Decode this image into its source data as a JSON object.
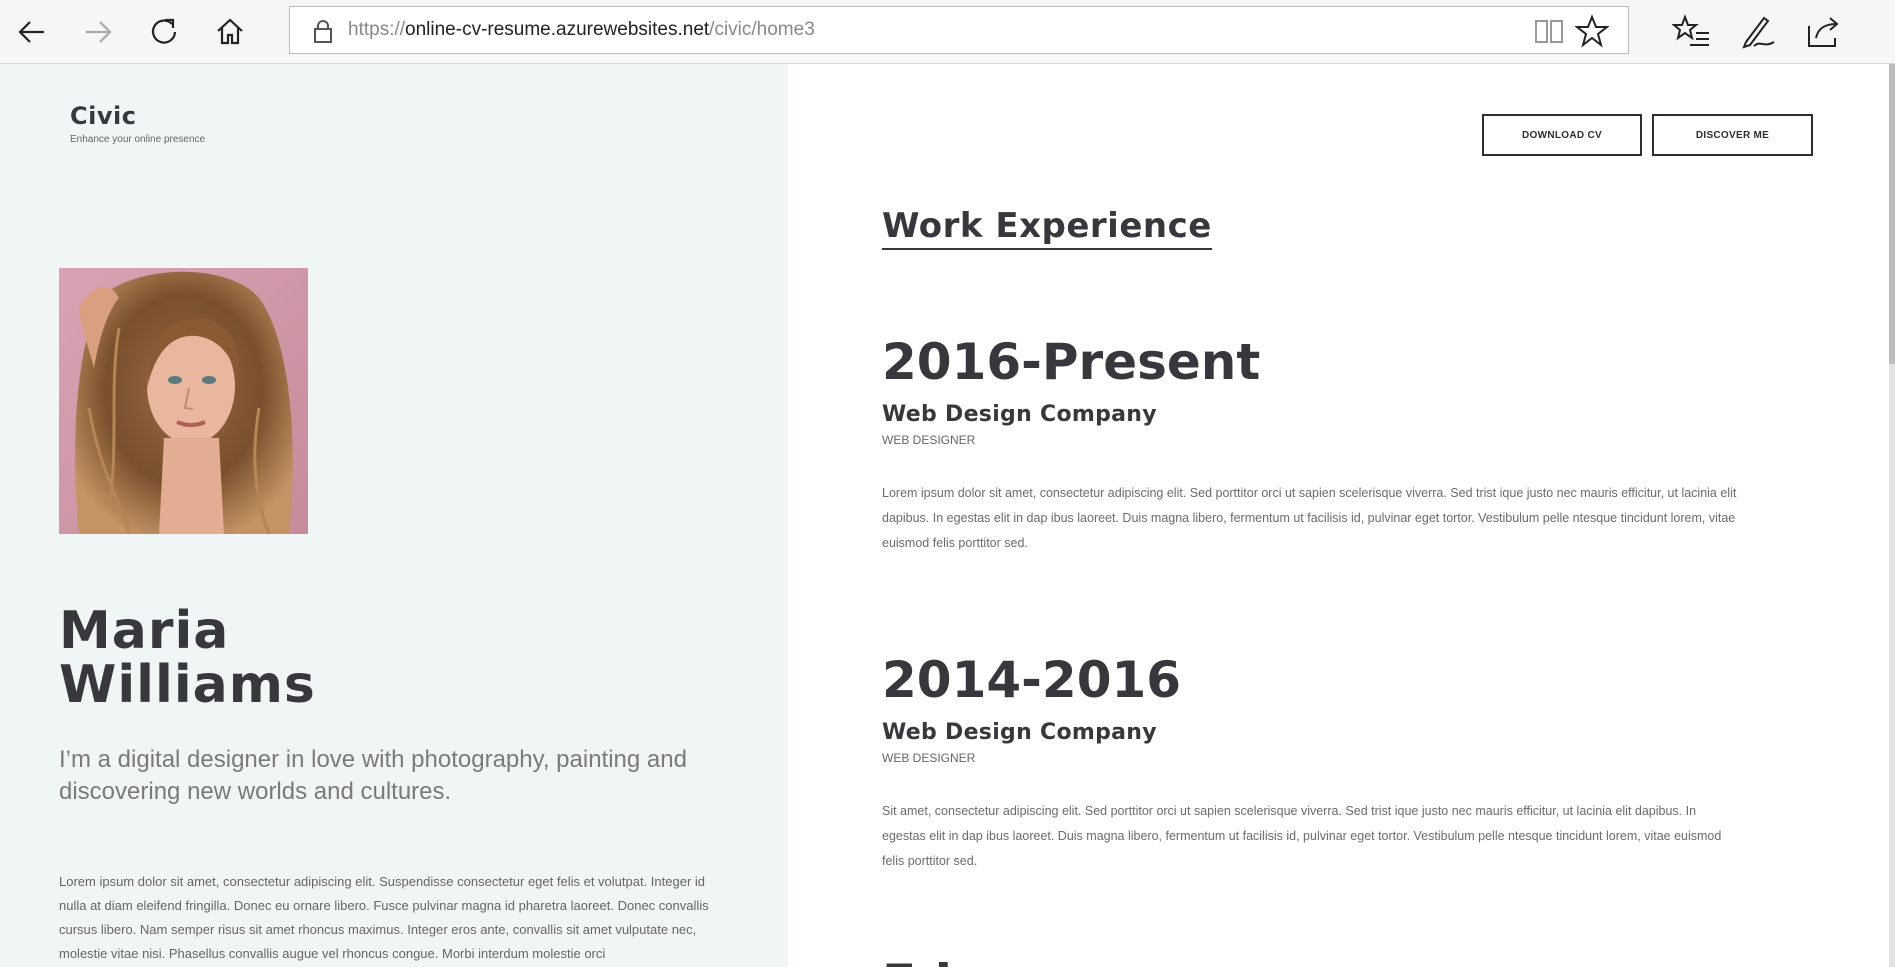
{
  "browser": {
    "url_scheme": "https://",
    "url_host": "online-cv-resume.azurewebsites.net",
    "url_path": "/civic/home3",
    "icons": [
      "back-icon",
      "forward-icon",
      "refresh-icon",
      "home-icon",
      "lock-icon",
      "reading-view-icon",
      "favorite-star-icon",
      "favorites-list-icon",
      "pen-icon",
      "share-icon"
    ]
  },
  "site": {
    "brand": "Civic",
    "tagline": "Enhance your online presence"
  },
  "profile": {
    "name_first": "Maria",
    "name_last": "Williams",
    "intro": "I’m a digital designer in love with photography, painting and discovering new worlds and cultures.",
    "bio": "Lorem ipsum dolor sit amet, consectetur adipiscing elit. Suspendisse consectetur eget felis et volutpat. Integer id nulla at diam eleifend fringilla. Donec eu ornare libero. Fusce pulvinar magna id pharetra laoreet. Donec convallis cursus libero. Nam semper risus sit amet rhoncus maximus. Integer eros ante, convallis sit amet vulputate nec, molestie vitae nisi. Phasellus convallis augue vel rhoncus congue. Morbi interdum molestie orci"
  },
  "actions": {
    "download": "DOWNLOAD CV",
    "discover": "DISCOVER ME"
  },
  "work": {
    "title": "Work Experience",
    "jobs": [
      {
        "period": "2016-Present",
        "company": "Web Design Company",
        "role": "WEB DESIGNER",
        "desc": "Lorem ipsum dolor sit amet, consectetur adipiscing elit. Sed porttitor orci ut sapien scelerisque viverra. Sed trist ique justo nec mauris efficitur, ut lacinia elit dapibus. In egestas elit in dap ibus laoreet. Duis magna libero, fermentum ut facilisis id, pulvinar eget tortor. Vestibulum pelle ntesque tincidunt lorem, vitae euismod felis porttitor sed."
      },
      {
        "period": "2014-2016",
        "company": "Web Design Company",
        "role": "WEB DESIGNER",
        "desc": "Sit amet, consectetur adipiscing elit. Sed porttitor orci ut sapien scelerisque viverra. Sed trist ique justo nec mauris efficitur, ut lacinia elit dapibus. In egestas elit in dap ibus laoreet. Duis magna libero, fermentum ut facilisis id, pulvinar eget tortor. Vestibulum pelle ntesque tincidunt lorem, vitae euismod felis porttitor sed."
      }
    ],
    "next_heading_partial": "Edu"
  },
  "colors": {
    "left_bg": "#f0f5f5",
    "heading": "#37383d",
    "body_text": "#6b6b6b"
  }
}
